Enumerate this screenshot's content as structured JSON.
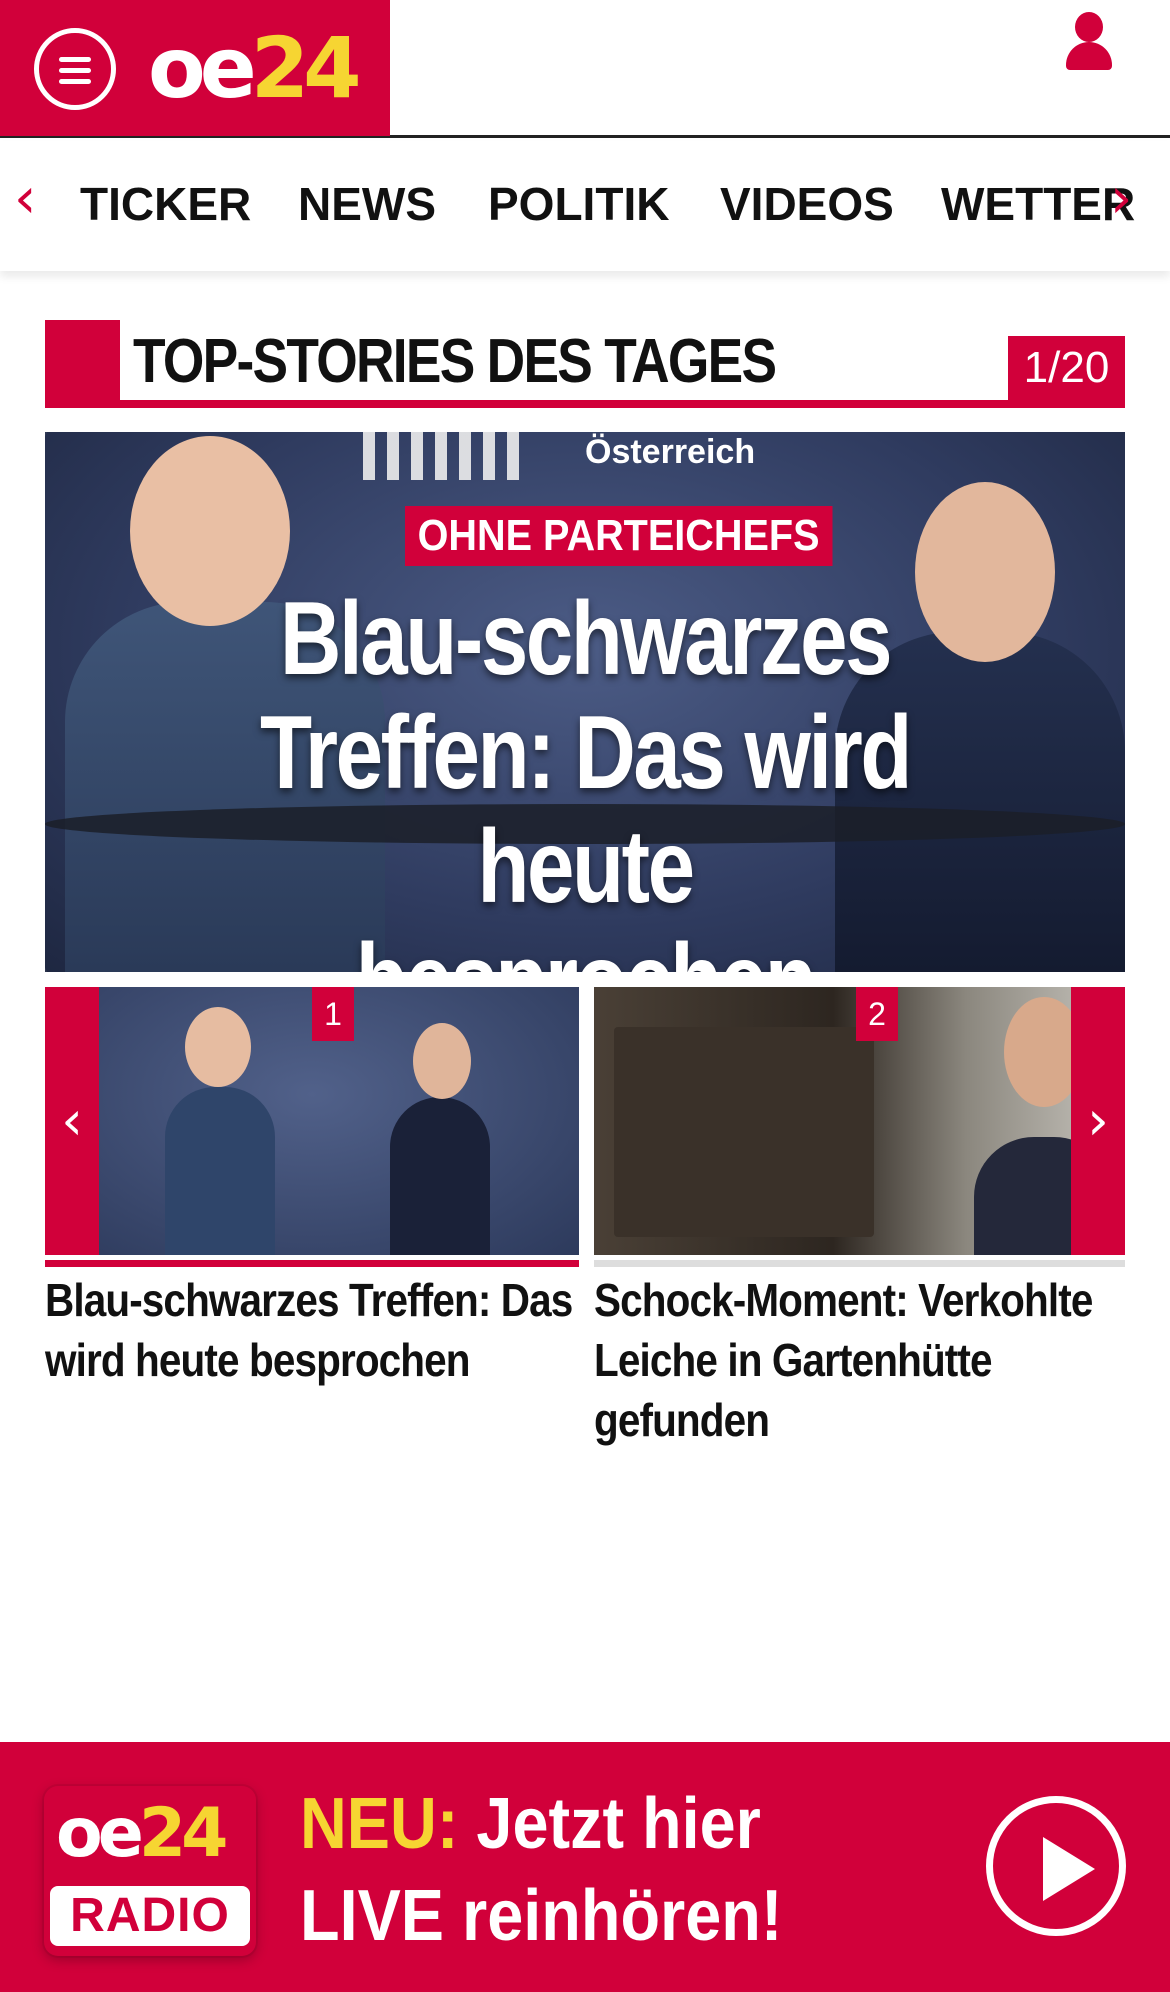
{
  "header": {
    "logo_oe": "oe",
    "logo_num": "24",
    "menu_icon": "hamburger-menu-icon",
    "user_icon": "user-icon"
  },
  "nav": {
    "prev_arrow": "‹",
    "next_arrow": "›",
    "items": [
      {
        "label": "TICKER"
      },
      {
        "label": "NEWS"
      },
      {
        "label": "POLITIK"
      },
      {
        "label": "VIDEOS"
      },
      {
        "label": "WETTER"
      }
    ]
  },
  "section": {
    "title": "TOP-STORIES DES TAGES",
    "counter": "1/20"
  },
  "hero": {
    "background_text": "Österreich",
    "tag": "OHNE PARTEICHEFS",
    "headline": "Blau-schwarzes Treffen: Das wird heute besprochen"
  },
  "carousel": {
    "prev": "‹",
    "next": "›",
    "items": [
      {
        "number": "1",
        "caption": "Blau-schwarzes Treffen: Das wird heute besprochen"
      },
      {
        "number": "2",
        "caption": "Schock-Moment: Verkohlte Leiche in Gartenhütte gefunden"
      }
    ]
  },
  "radio": {
    "logo_oe": "oe",
    "logo_num": "24",
    "logo_radio": "RADIO",
    "neu": "NEU:",
    "line1": "Jetzt hier",
    "line2": "LIVE reinhören!",
    "play_icon": "play-icon"
  },
  "colors": {
    "brand_red": "#d1003a",
    "brand_yellow": "#f6d532"
  }
}
